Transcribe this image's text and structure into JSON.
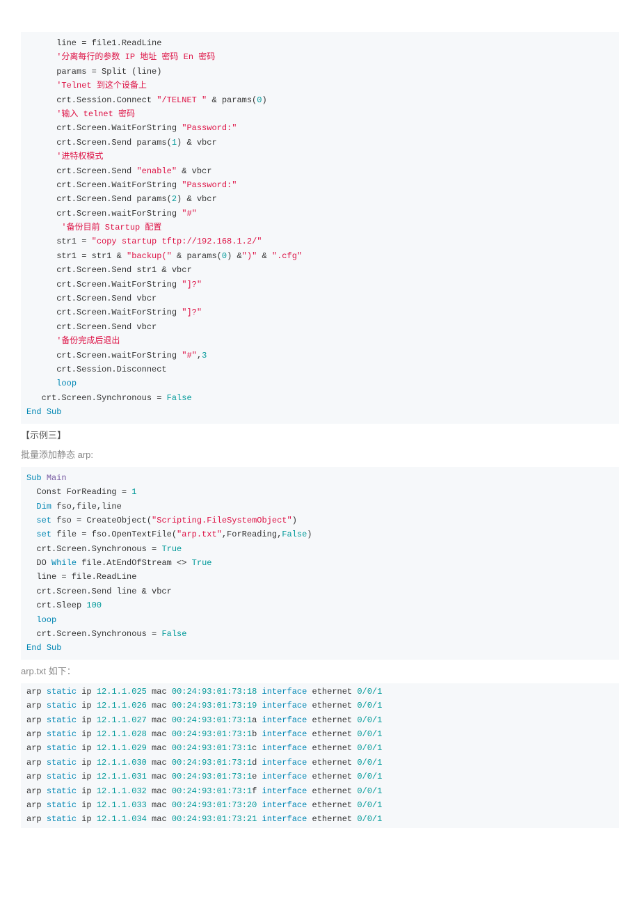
{
  "code1": {
    "l1": "      line = file1.ReadLine",
    "c1a": "      '",
    "c1b": "分离每行的参数 IP 地址 密码 En 密码",
    "l2": "      params = Split (line)",
    "c2a": "      '",
    "c2b": "Telnet 到这个设备上",
    "l3a": "      crt.Session.Connect ",
    "l3b": "\"/TELNET \"",
    "l3c": " & params(",
    "l3d": "0",
    "l3e": ")",
    "c3a": "      '",
    "c3b": "输入 telnet 密码",
    "l4a": "      crt.Screen.WaitForString ",
    "l4b": "\"Password:\"",
    "l5a": "      crt.Screen.Send params(",
    "l5b": "1",
    "l5c": ") & vbcr",
    "c4a": "      '",
    "c4b": "进特权模式",
    "l6a": "      crt.Screen.Send ",
    "l6b": "\"enable\"",
    "l6c": " & vbcr",
    "l7a": "      crt.Screen.WaitForString ",
    "l7b": "\"Password:\"",
    "l8a": "      crt.Screen.Send params(",
    "l8b": "2",
    "l8c": ") & vbcr",
    "l9a": "      crt.Screen.waitForString ",
    "l9b": "\"#\"",
    "c5a": "       '",
    "c5b": "备份目前 Startup 配置",
    "l10a": "      str1 = ",
    "l10b": "\"copy startup tftp://192.168.1.2/\"",
    "l11a": "      str1 = str1 & ",
    "l11b": "\"backup(\"",
    "l11c": " & params(",
    "l11d": "0",
    "l11e": ") &",
    "l11f": "\")\"",
    "l11g": " & ",
    "l11h": "\".cfg\"",
    "l12": "      crt.Screen.Send str1 & vbcr",
    "l13a": "      crt.Screen.WaitForString ",
    "l13b": "\"]?\"",
    "l14": "      crt.Screen.Send vbcr",
    "l15a": "      crt.Screen.WaitForString ",
    "l15b": "\"]?\"",
    "l16": "      crt.Screen.Send vbcr",
    "c6a": "      '",
    "c6b": "备份完成后退出",
    "l17a": "      crt.Screen.waitForString ",
    "l17b": "\"#\"",
    "l17c": ",",
    "l17d": "3",
    "l18": "      crt.Session.Disconnect",
    "l19a": "      ",
    "l19b": "loop",
    "l20a": "   crt.Screen.Synchronous = ",
    "l20b": "False",
    "l21a": "End",
    "l21b": " ",
    "l21c": "Sub"
  },
  "h1": "【示例三】",
  "h2": "批量添加静态 arp:",
  "code2": {
    "l1a": "Sub",
    "l1b": " ",
    "l1c": "Main",
    "l2a": "  Const ForReading = ",
    "l2b": "1",
    "l3a": "  ",
    "l3b": "Dim",
    "l3c": " fso,file,line",
    "l4a": "  ",
    "l4b": "set",
    "l4c": " fso = CreateObject(",
    "l4d": "\"Scripting.FileSystemObject\"",
    "l4e": ")",
    "l5a": "  ",
    "l5b": "set",
    "l5c": " file = fso.OpenTextFile(",
    "l5d": "\"arp.txt\"",
    "l5e": ",ForReading,",
    "l5f": "False",
    "l5g": ")",
    "l6a": "  crt.Screen.Synchronous = ",
    "l6b": "True",
    "l7a": "  DO ",
    "l7b": "While",
    "l7c": " file.AtEndOfStream <> ",
    "l7d": "True",
    "l8": "  line = file.ReadLine",
    "l9": "  crt.Screen.Send line & vbcr",
    "l10a": "  crt.Sleep ",
    "l10b": "100",
    "l11a": "  ",
    "l11b": "loop",
    "l12a": "  crt.Screen.Synchronous = ",
    "l12b": "False",
    "l13a": "End",
    "l13b": " ",
    "l13c": "Sub"
  },
  "h3": "arp.txt 如下：",
  "arp": [
    {
      "ip": "12.1.1.025",
      "mac": "00:24:93:01:73:18",
      "if": "0/0/1"
    },
    {
      "ip": "12.1.1.026",
      "mac": "00:24:93:01:73:19",
      "if": "0/0/1"
    },
    {
      "ip": "12.1.1.027",
      "mac": "00:24:93:01:73:1",
      "mh": "a",
      "if": "0/0/1"
    },
    {
      "ip": "12.1.1.028",
      "mac": "00:24:93:01:73:1",
      "mh": "b",
      "if": "0/0/1"
    },
    {
      "ip": "12.1.1.029",
      "mac": "00:24:93:01:73:1",
      "mh": "c",
      "if": "0/0/1"
    },
    {
      "ip": "12.1.1.030",
      "mac": "00:24:93:01:73:1",
      "mh": "d",
      "if": "0/0/1"
    },
    {
      "ip": "12.1.1.031",
      "mac": "00:24:93:01:73:1",
      "mh": "e",
      "if": "0/0/1"
    },
    {
      "ip": "12.1.1.032",
      "mac": "00:24:93:01:73:1",
      "mh": "f",
      "if": "0/0/1"
    },
    {
      "ip": "12.1.1.033",
      "mac": "00:24:93:01:73:20",
      "if": "0/0/1"
    },
    {
      "ip": "12.1.1.034",
      "mac": "00:24:93:01:73:21",
      "if": "0/0/1"
    }
  ],
  "arpw": {
    "arp": "arp ",
    "static": "static",
    "ip": " ip ",
    "mac": " mac ",
    "iface": " interface",
    "eth": " ethernet "
  }
}
